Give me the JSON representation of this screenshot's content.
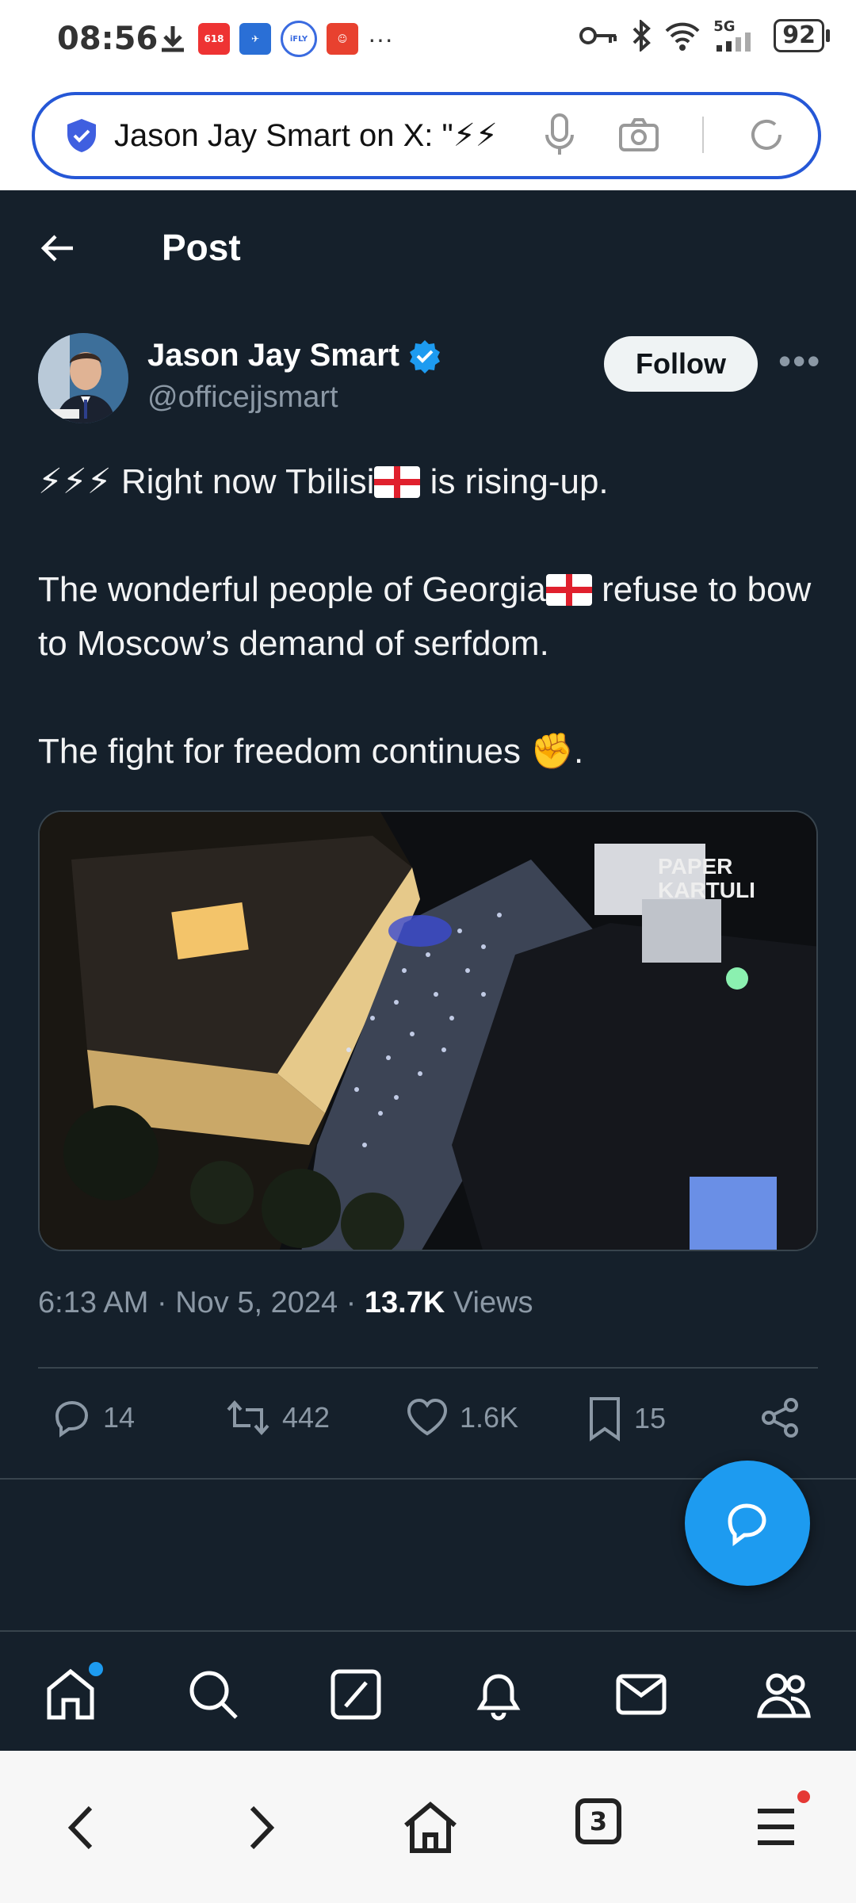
{
  "status_bar": {
    "time": "08:56",
    "battery": "92",
    "network": "5G",
    "app_icons": [
      "download-icon",
      "app-618-icon",
      "app-bird-icon",
      "ifly-icon",
      "app-red-icon"
    ],
    "more": "···"
  },
  "browser": {
    "url_text": "Jason Jay Smart on X: \"⚡⚡",
    "tab_count": "3"
  },
  "header": {
    "title": "Post"
  },
  "author": {
    "name": "Jason Jay Smart",
    "handle": "@officejjsmart",
    "follow_label": "Follow",
    "more": "•••"
  },
  "tweet": {
    "line1_prefix": "⚡⚡⚡ Right now Tbilisi",
    "line1_suffix": " is rising-up.",
    "para2_prefix": "The wonderful people of Georgia",
    "para2_suffix": " refuse to bow to Moscow’s demand of serfdom.",
    "para3_prefix": "The fight for freedom continues ",
    "para3_emoji": "✊",
    "para3_suffix": "."
  },
  "media": {
    "watermark_line1": "PAPER",
    "watermark_line2": "KARTULI"
  },
  "meta": {
    "time": "6:13 AM",
    "separator": " · ",
    "date": "Nov 5, 2024",
    "views_count": "13.7K",
    "views_label": " Views"
  },
  "actions": {
    "replies": "14",
    "reposts": "442",
    "likes": "1.6K",
    "bookmarks": "15"
  },
  "colors": {
    "background": "#15202b",
    "accent": "#1d9bf0",
    "muted": "#8b98a5",
    "url_border": "#2557d6"
  }
}
